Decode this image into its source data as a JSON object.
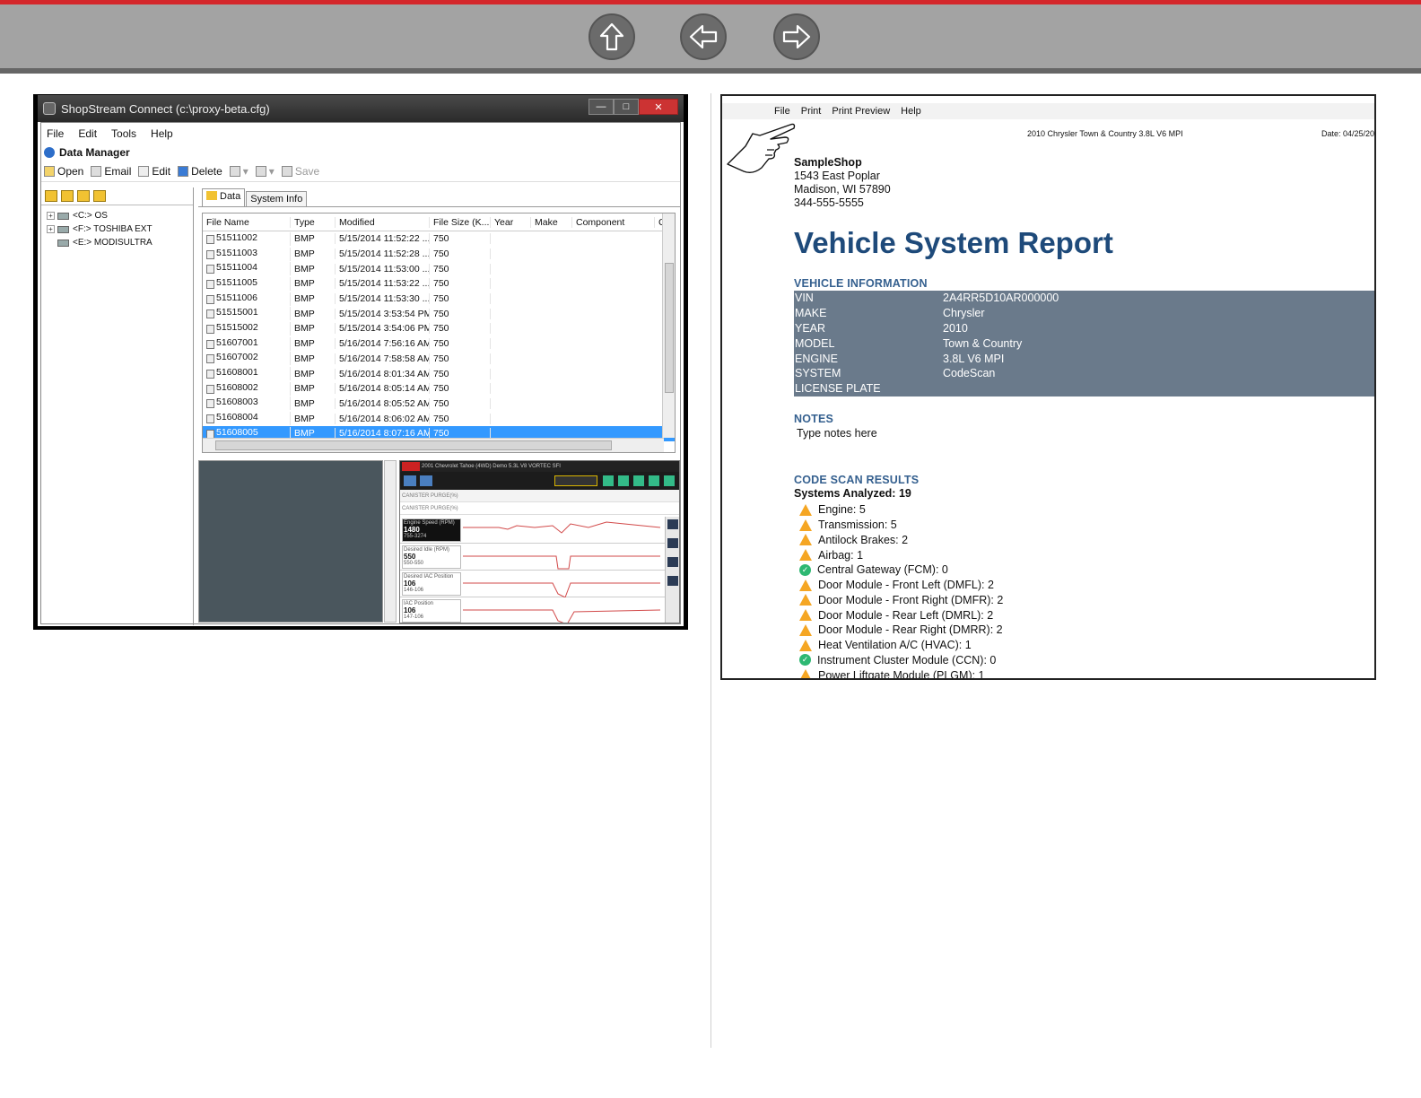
{
  "colors": {
    "accent_red": "#d4262b",
    "nav_gray": "#a3a3a3",
    "report_blue": "#1e4a7a",
    "row_gray": "#6a7a8b"
  },
  "nav": {
    "buttons": [
      {
        "icon": "up-arrow-icon"
      },
      {
        "icon": "left-arrow-icon"
      },
      {
        "icon": "right-arrow-icon"
      }
    ]
  },
  "app": {
    "title": "ShopStream Connect (c:\\proxy-beta.cfg)",
    "menu": [
      "File",
      "Edit",
      "Tools",
      "Help"
    ],
    "panel_title": "Data Manager",
    "toolbar": {
      "open": "Open",
      "email": "Email",
      "edit": "Edit",
      "delete": "Delete",
      "save": "Save"
    },
    "tree": [
      {
        "label": "<C:> OS"
      },
      {
        "label": "<F:> TOSHIBA EXT"
      },
      {
        "label": "<E:> MODISULTRA"
      }
    ],
    "tabs": [
      "Data",
      "System Info"
    ],
    "columns": [
      "File Name",
      "Type",
      "Modified",
      "File Size (K...",
      "Year",
      "Make",
      "Component",
      "C"
    ],
    "rows": [
      {
        "name": "51511002",
        "type": "BMP",
        "modified": "5/15/2014 11:52:22 ...",
        "size": "750"
      },
      {
        "name": "51511003",
        "type": "BMP",
        "modified": "5/15/2014 11:52:28 ...",
        "size": "750"
      },
      {
        "name": "51511004",
        "type": "BMP",
        "modified": "5/15/2014 11:53:00 ...",
        "size": "750"
      },
      {
        "name": "51511005",
        "type": "BMP",
        "modified": "5/15/2014 11:53:22 ...",
        "size": "750"
      },
      {
        "name": "51511006",
        "type": "BMP",
        "modified": "5/15/2014 11:53:30 ...",
        "size": "750"
      },
      {
        "name": "51515001",
        "type": "BMP",
        "modified": "5/15/2014 3:53:54 PM",
        "size": "750"
      },
      {
        "name": "51515002",
        "type": "BMP",
        "modified": "5/15/2014 3:54:06 PM",
        "size": "750"
      },
      {
        "name": "51607001",
        "type": "BMP",
        "modified": "5/16/2014 7:56:16 AM",
        "size": "750"
      },
      {
        "name": "51607002",
        "type": "BMP",
        "modified": "5/16/2014 7:58:58 AM",
        "size": "750"
      },
      {
        "name": "51608001",
        "type": "BMP",
        "modified": "5/16/2014 8:01:34 AM",
        "size": "750"
      },
      {
        "name": "51608002",
        "type": "BMP",
        "modified": "5/16/2014 8:05:14 AM",
        "size": "750"
      },
      {
        "name": "51608003",
        "type": "BMP",
        "modified": "5/16/2014 8:05:52 AM",
        "size": "750"
      },
      {
        "name": "51608004",
        "type": "BMP",
        "modified": "5/16/2014 8:06:02 AM",
        "size": "750"
      },
      {
        "name": "51608005",
        "type": "BMP",
        "modified": "5/16/2014 8:07:16 AM",
        "size": "750",
        "selected": true
      }
    ],
    "scanner": {
      "header": "2001 Chevrolet Tahoe (4WD) Demo 5.3L V8 VORTEC SFI",
      "row1": "CANISTER PURGE(%)",
      "row2": "CANISTER PURGE(%)",
      "graphs": [
        {
          "label": "Engine Speed (RPM)",
          "value": "1480",
          "range": "755-3274"
        },
        {
          "label": "Desired Idle (RPM)",
          "value": "550",
          "range": "550-550"
        },
        {
          "label": "Desired IAC Position",
          "value": "106",
          "range": "146-106"
        },
        {
          "label": "IAC Position",
          "value": "106",
          "range": "147-106"
        }
      ]
    }
  },
  "report": {
    "menu": [
      "File",
      "Print",
      "Print Preview",
      "Help"
    ],
    "vehicle_header": "2010 Chrysler Town & Country 3.8L V6 MPI",
    "date": "Date: 04/25/20",
    "shop": {
      "name": "SampleShop",
      "address1": "1543 East Poplar",
      "address2": "Madison, WI 57890",
      "phone": "344-555-5555"
    },
    "title": "Vehicle System Report",
    "vehicle_info_heading": "VEHICLE INFORMATION",
    "vehicle_info": [
      {
        "key": "VIN",
        "value": "2A4RR5D10AR000000"
      },
      {
        "key": "MAKE",
        "value": "Chrysler"
      },
      {
        "key": "YEAR",
        "value": "2010"
      },
      {
        "key": "MODEL",
        "value": "Town & Country"
      },
      {
        "key": "ENGINE",
        "value": "3.8L V6 MPI"
      },
      {
        "key": "SYSTEM",
        "value": "CodeScan"
      },
      {
        "key": "LICENSE PLATE",
        "value": ""
      }
    ],
    "notes_heading": "NOTES",
    "notes": "Type notes here",
    "code_scan_heading": "CODE SCAN RESULTS",
    "systems_analyzed": "Systems Analyzed: 19",
    "codes": [
      {
        "status": "warning",
        "text": "Engine: 5"
      },
      {
        "status": "warning",
        "text": "Transmission: 5"
      },
      {
        "status": "warning",
        "text": "Antilock Brakes: 2"
      },
      {
        "status": "warning",
        "text": "Airbag: 1"
      },
      {
        "status": "ok",
        "text": "Central Gateway (FCM): 0"
      },
      {
        "status": "warning",
        "text": "Door Module - Front Left (DMFL): 2"
      },
      {
        "status": "warning",
        "text": "Door Module - Front Right (DMFR): 2"
      },
      {
        "status": "warning",
        "text": "Door Module - Rear Left (DMRL): 2"
      },
      {
        "status": "warning",
        "text": "Door Module - Rear Right (DMRR): 2"
      },
      {
        "status": "warning",
        "text": "Heat Ventilation A/C (HVAC): 1"
      },
      {
        "status": "ok",
        "text": "Instrument Cluster Module (CCN): 0"
      },
      {
        "status": "warning",
        "text": "Power Liftgate Module (PLGM): 1"
      }
    ]
  }
}
